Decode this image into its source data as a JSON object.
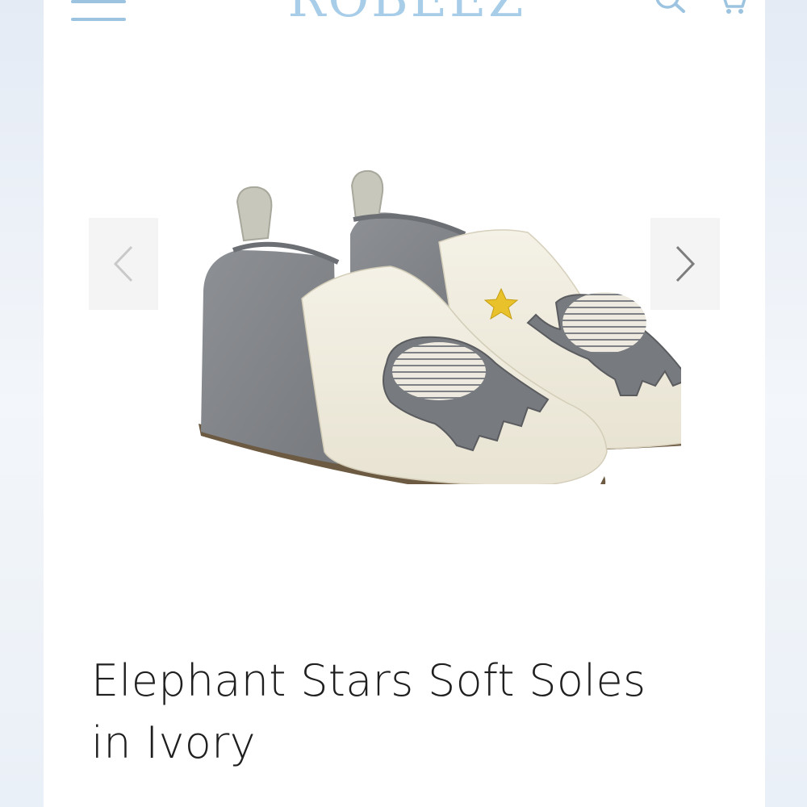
{
  "header": {
    "brand": "ROBEEZ",
    "icons": {
      "menu": "hamburger-menu-icon",
      "search": "search-icon",
      "cart": "cart-icon"
    },
    "accent_color": "#9cc3e0"
  },
  "carousel": {
    "prev_icon": "chevron-left-icon",
    "next_icon": "chevron-right-icon"
  },
  "product": {
    "title_line1": "Elephant Stars Soft Soles",
    "title_line2": "in Ivory"
  }
}
